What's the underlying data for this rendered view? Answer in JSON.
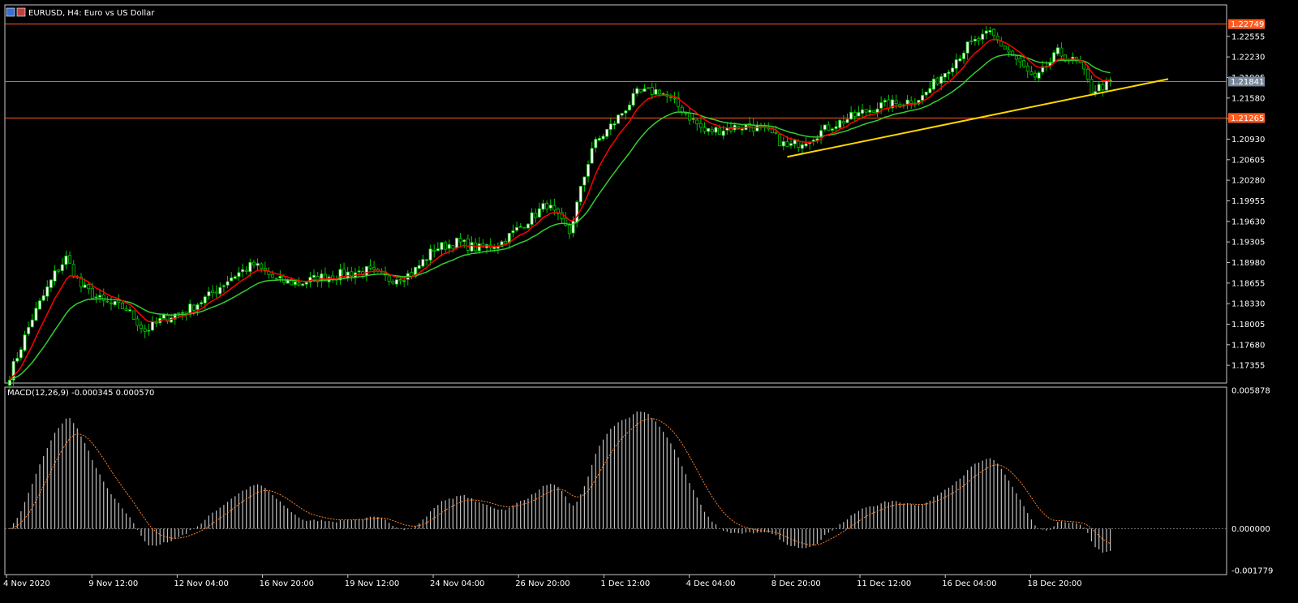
{
  "header": {
    "symbol": "EURUSD",
    "timeframe": "H4",
    "description": "Euro vs US Dollar",
    "title": "EURUSD, H4:  Euro vs US Dollar"
  },
  "colors": {
    "background": "#000000",
    "bull_candle": "#ffffff",
    "bear_candle": "#000000",
    "candle_wick": "#00c800",
    "ma_fast": "#ff0000",
    "ma_slow": "#32cd32",
    "trendline": "#ffd700",
    "hline": "#ff5a1f",
    "bid_line": "#778899",
    "macd_hist": "#c0c0c0",
    "macd_signal": "#ff7f27",
    "zero_line": "#808080",
    "axis_text": "#ffffff"
  },
  "price_axis": {
    "labels": [
      "1.22555",
      "1.22230",
      "1.21905",
      "1.21580",
      "1.21255",
      "1.20930",
      "1.20605",
      "1.20280",
      "1.19955",
      "1.19630",
      "1.19305",
      "1.18980",
      "1.18655",
      "1.18330",
      "1.18005",
      "1.17680",
      "1.17355"
    ],
    "tags": [
      {
        "label": "1.22749",
        "color": "#ff5a1f",
        "kind": "resistance"
      },
      {
        "label": "1.21841",
        "color": "#778899",
        "kind": "bid"
      },
      {
        "label": "1.21265",
        "color": "#ff5a1f",
        "kind": "support"
      }
    ]
  },
  "time_axis": {
    "labels": [
      "4 Nov 2020",
      "9 Nov 12:00",
      "12 Nov 04:00",
      "16 Nov 20:00",
      "19 Nov 12:00",
      "24 Nov 04:00",
      "26 Nov 20:00",
      "1 Dec 12:00",
      "4 Dec 04:00",
      "8 Dec 20:00",
      "11 Dec 12:00",
      "16 Dec 04:00",
      "18 Dec 20:00"
    ]
  },
  "macd": {
    "label": "MACD(12,26,9) -0.000345 0.000570",
    "axis_labels": [
      "0.005878",
      "0.000000",
      "-0.001779"
    ]
  },
  "chart_data": {
    "type": "candlestick",
    "title": "EURUSD, H4:  Euro vs US Dollar",
    "ylim": [
      1.171,
      1.2295
    ],
    "x_start": "4 Nov 2020",
    "x_end": "21 Dec 2020",
    "anchors": [
      [
        0,
        1.172
      ],
      [
        6,
        1.181
      ],
      [
        12,
        1.188
      ],
      [
        15,
        1.1905
      ],
      [
        19,
        1.186
      ],
      [
        25,
        1.1835
      ],
      [
        31,
        1.1825
      ],
      [
        36,
        1.179
      ],
      [
        41,
        1.181
      ],
      [
        47,
        1.1822
      ],
      [
        53,
        1.1845
      ],
      [
        59,
        1.1875
      ],
      [
        65,
        1.1895
      ],
      [
        71,
        1.187
      ],
      [
        77,
        1.1865
      ],
      [
        83,
        1.1875
      ],
      [
        89,
        1.188
      ],
      [
        95,
        1.1885
      ],
      [
        101,
        1.1872
      ],
      [
        107,
        1.188
      ],
      [
        113,
        1.192
      ],
      [
        119,
        1.193
      ],
      [
        125,
        1.192
      ],
      [
        131,
        1.193
      ],
      [
        137,
        1.196
      ],
      [
        143,
        1.199
      ],
      [
        149,
        1.1945
      ],
      [
        155,
        1.208
      ],
      [
        161,
        1.212
      ],
      [
        167,
        1.2165
      ],
      [
        173,
        1.217
      ],
      [
        179,
        1.214
      ],
      [
        185,
        1.2105
      ],
      [
        191,
        1.211
      ],
      [
        197,
        1.2115
      ],
      [
        203,
        1.21
      ],
      [
        207,
        1.208
      ],
      [
        213,
        1.2095
      ],
      [
        219,
        1.2115
      ],
      [
        225,
        1.213
      ],
      [
        231,
        1.2145
      ],
      [
        237,
        1.215
      ],
      [
        243,
        1.216
      ],
      [
        249,
        1.22
      ],
      [
        255,
        1.224
      ],
      [
        261,
        1.226
      ],
      [
        267,
        1.2225
      ],
      [
        273,
        1.2185
      ],
      [
        279,
        1.223
      ],
      [
        285,
        1.221
      ],
      [
        288,
        1.217
      ],
      [
        293,
        1.2182
      ]
    ],
    "ma_fast_period": 8,
    "ma_slow_period": 21,
    "support_trendline": {
      "from": "8 Dec 20:00",
      "y_from": 1.2065,
      "to": "22 Dec",
      "y_to": 1.2188
    },
    "horizontal_lines": [
      1.22749,
      1.21265
    ],
    "bid": 1.21841,
    "macd": {
      "fast": 12,
      "slow": 26,
      "signal": 9,
      "value": -0.000345,
      "signal_value": 0.00057,
      "ylim": [
        -0.001779,
        0.005878
      ]
    }
  }
}
